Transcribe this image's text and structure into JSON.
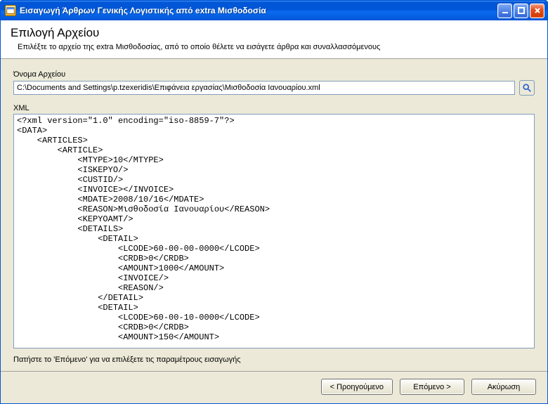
{
  "window": {
    "title": "Εισαγωγή Άρθρων Γενικής Λογιστικής από extra Μισθοδοσία"
  },
  "header": {
    "title": "Επιλογή Αρχείου",
    "subtitle": "Επιλέξτε το αρχείο της extra Μισθοδοσίας, από το οποίο θέλετε να εισάγετε άρθρα και συναλλασσόμενους"
  },
  "file": {
    "label": "Όνομα Αρχείου",
    "path": "C:\\Documents and Settings\\p.tzexeridis\\Επιφάνεια εργασίας\\Μισθοδοσία Ιανουαρίου.xml"
  },
  "xml": {
    "label": "XML",
    "content": "<?xml version=\"1.0\" encoding=\"iso-8859-7\"?>\n<DATA>\n    <ARTICLES>\n        <ARTICLE>\n            <MTYPE>10</MTYPE>\n            <ISKEPYO/>\n            <CUSTID/>\n            <INVOICE></INVOICE>\n            <MDATE>2008/10/16</MDATE>\n            <REASON>Μισθοδοσία Ιανουαρίου</REASON>\n            <KEPYOAMT/>\n            <DETAILS>\n                <DETAIL>\n                    <LCODE>60-00-00-0000</LCODE>\n                    <CRDB>0</CRDB>\n                    <AMOUNT>1000</AMOUNT>\n                    <INVOICE/>\n                    <REASON/>\n                </DETAIL>\n                <DETAIL>\n                    <LCODE>60-00-10-0000</LCODE>\n                    <CRDB>0</CRDB>\n                    <AMOUNT>150</AMOUNT>"
  },
  "footer": {
    "hint": "Πατήστε το 'Επόμενο' για να επιλέξετε τις παραμέτρους εισαγωγής"
  },
  "buttons": {
    "back": "< Προηγούμενο",
    "next": "Επόμενο >",
    "cancel": "Ακύρωση"
  }
}
